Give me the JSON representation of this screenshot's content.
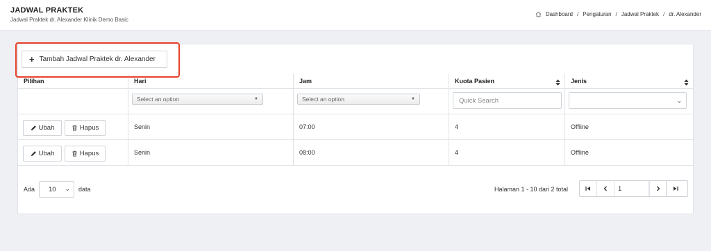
{
  "header": {
    "title": "JADWAL PRAKTEK",
    "subtitle": "Jadwal Praktek dr. Alexander Klinik Demo Basic",
    "breadcrumb": [
      "Dashboard",
      "Pengaturan",
      "Jadwal Praktek",
      "dr. Alexander"
    ]
  },
  "toolbar": {
    "add_label": "Tambah Jadwal Praktek dr. Alexander"
  },
  "table": {
    "columns": [
      "Pilihan",
      "Hari",
      "Jam",
      "Kuota Pasien",
      "Jenis"
    ],
    "filters": {
      "hari_placeholder": "Select an option",
      "jam_placeholder": "Select an option",
      "kuota_placeholder": "Quick Search"
    },
    "action_labels": {
      "edit": "Ubah",
      "delete": "Hapus"
    },
    "rows": [
      {
        "hari": "Senin",
        "jam": "07:00",
        "kuota": "4",
        "jenis": "Offline"
      },
      {
        "hari": "Senin",
        "jam": "08:00",
        "kuota": "4",
        "jenis": "Offline"
      }
    ]
  },
  "footer": {
    "ada_label": "Ada",
    "per_page": "10",
    "data_label": "data",
    "page_info": "Halaman 1 - 10 dari 2 total",
    "current_page": "1"
  },
  "colors": {
    "highlight": "#e8402a",
    "border": "#dfe2e6",
    "background": "#eef0f4"
  }
}
